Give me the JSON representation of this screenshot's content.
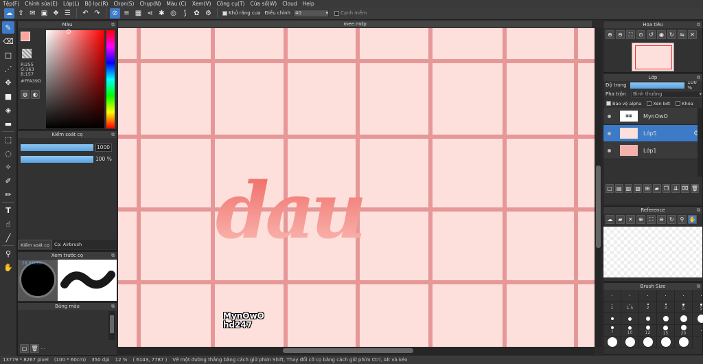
{
  "menu": [
    "Tệp(F)",
    "Chỉnh sửa(E)",
    "Lớp(L)",
    "Bộ lọc(R)",
    "Chọn(S)",
    "Chụp(N)",
    "Màu (C)",
    "Xem(V)",
    "Công cụ(T)",
    "Cửa sổ(W)",
    "Cloud",
    "Help"
  ],
  "toolbar": {
    "antialias_label": "Khử răng cưa",
    "adjust_label": "Điều chỉnh",
    "adjust_value": "40",
    "edge_label": "Cạnh mềm"
  },
  "color_panel": {
    "title": "Màu",
    "r": "R:255",
    "g": "G:163",
    "b": "B:157",
    "hex": "#FFA39D",
    "fg_color": "#ffa39d",
    "bg_color": "#4da3e0"
  },
  "brush_control": {
    "title": "Kiểm soát cọ",
    "size_value": "1000",
    "opacity_value": "100 %",
    "tab1": "Kiểm soát cọ",
    "tab2": "Cọ: Airbrush"
  },
  "brush_preview": {
    "title": "Xem trước cọ",
    "size_label": "28.57mm"
  },
  "palette": {
    "title": "Bảng màu"
  },
  "canvas": {
    "tab": "mee.mdp",
    "bg_color": "#fde0dc",
    "grid_color": "#e38b8b",
    "text_main": "dau",
    "watermark1": "MynOwO",
    "watermark2": "hd247"
  },
  "navigator": {
    "title": "Hoa tiêu"
  },
  "layers": {
    "title": "Lớp",
    "opacity_label": "Độ trong",
    "opacity_value": "100 %",
    "blend_label": "Pha trộn",
    "blend_value": "Bình thường",
    "protect_alpha": "Bảo vệ alpha",
    "clipping": "Xén bớt",
    "lock": "Khóa",
    "items": [
      {
        "name": "MynOwO"
      },
      {
        "name": "Lớp5"
      },
      {
        "name": "Lớp1"
      }
    ]
  },
  "reference": {
    "title": "Reference"
  },
  "brush_size": {
    "title": "Brush Size",
    "rows": [
      [
        "",
        "",
        "",
        "",
        "",
        ""
      ],
      [
        "1",
        "1.5",
        "2",
        "3",
        "5",
        "5"
      ],
      [
        "7",
        "10",
        "12",
        "15",
        "20",
        ""
      ],
      [
        "",
        "",
        "",
        "",
        "",
        ""
      ]
    ]
  },
  "status": {
    "size": "13779 * 8267 pixel",
    "cm": "(100 * 60cm)",
    "dpi": "350 dpi",
    "zoom": "12 %",
    "coords": "( 6143, 7787 )",
    "hint": "Vẽ một đường thẳng bằng cách giữ phím Shift, Thay đổi cỡ cọ bằng cách giữ phím Ctrl, Alt và kéo"
  }
}
